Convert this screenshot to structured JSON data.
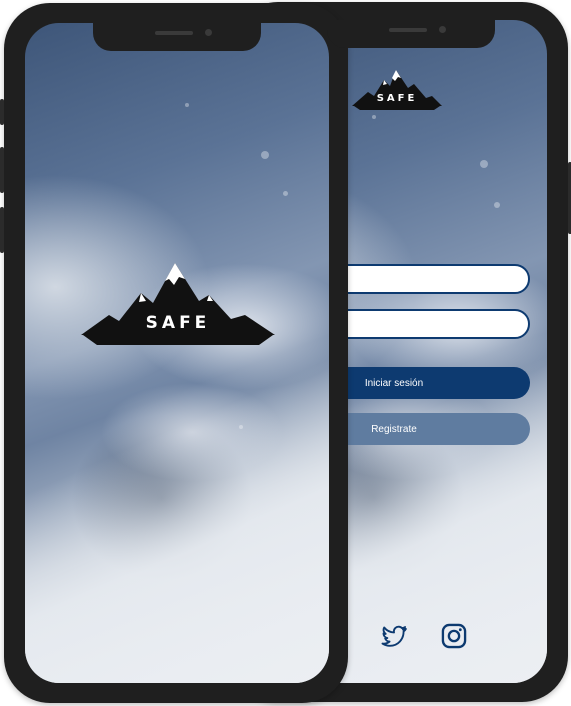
{
  "app": {
    "brand": "SAFE"
  },
  "splash": {
    "logo_text": "SAFE"
  },
  "login": {
    "logo_text": "SAFE",
    "username_placeholder": "",
    "password_placeholder": "",
    "login_button": "Iniciar sesión",
    "register_button": "Registrate",
    "social": [
      "twitter-icon",
      "instagram-icon"
    ]
  },
  "colors": {
    "primary": "#0d3a70",
    "secondary": "#5f7ca0",
    "frame": "#1f1f1f"
  }
}
